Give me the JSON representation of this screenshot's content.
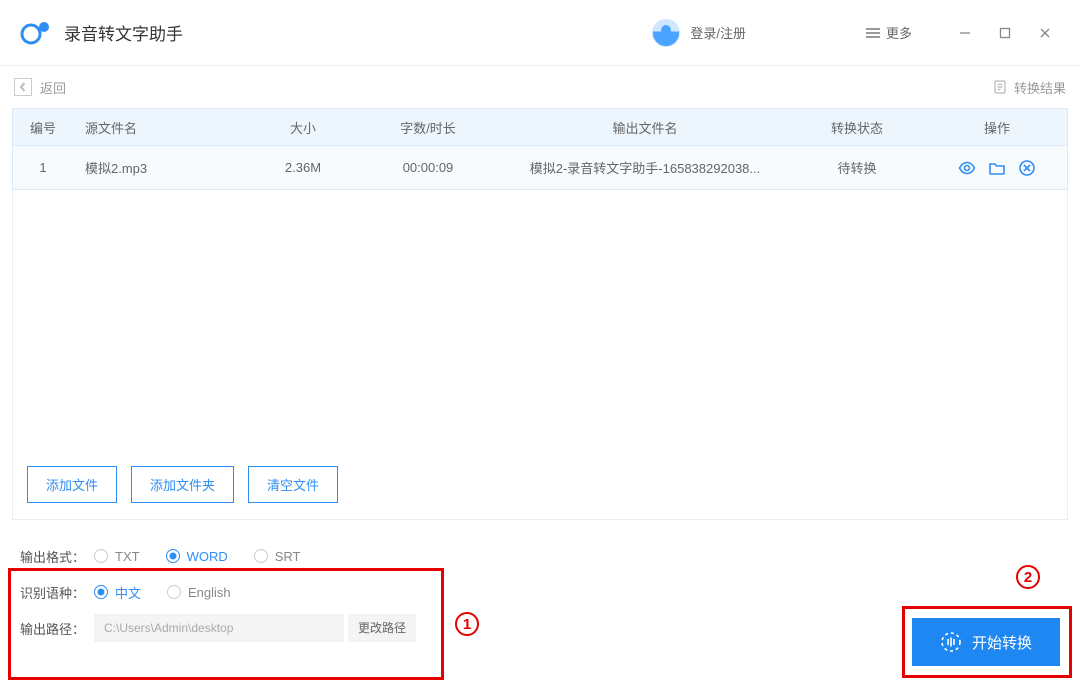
{
  "header": {
    "app_title": "录音转文字助手",
    "login_label": "登录/注册",
    "more_label": "更多"
  },
  "toolbar": {
    "back_label": "返回",
    "result_label": "转换结果"
  },
  "table": {
    "headers": {
      "idx": "编号",
      "source": "源文件名",
      "size": "大小",
      "duration": "字数/时长",
      "output": "输出文件名",
      "status": "转换状态",
      "actions": "操作"
    },
    "rows": [
      {
        "idx": "1",
        "source": "模拟2.mp3",
        "size": "2.36M",
        "duration": "00:00:09",
        "output": "模拟2-录音转文字助手-165838292038...",
        "status": "待转换"
      }
    ]
  },
  "list_buttons": {
    "add_file": "添加文件",
    "add_folder": "添加文件夹",
    "clear": "清空文件"
  },
  "settings": {
    "format_label": "输出格式：",
    "formats": {
      "txt": "TXT",
      "word": "WORD",
      "srt": "SRT"
    },
    "format_selected": "word",
    "lang_label": "识别语种：",
    "langs": {
      "zh": "中文",
      "en": "English"
    },
    "lang_selected": "zh",
    "path_label": "输出路径：",
    "path_value": "C:\\Users\\Admin\\desktop",
    "change_path_label": "更改路径"
  },
  "start_button": "开始转换",
  "annotations": {
    "one": "1",
    "two": "2"
  },
  "colors": {
    "accent": "#1f87f2",
    "annotation": "#e60000"
  }
}
